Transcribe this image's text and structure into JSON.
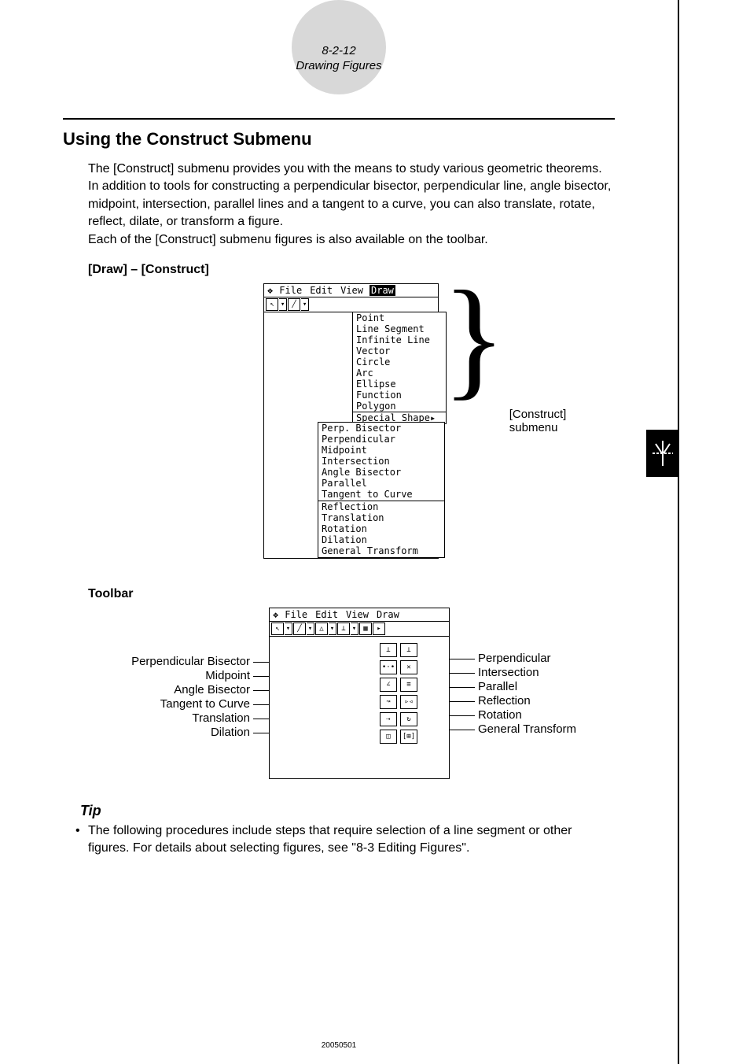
{
  "header": {
    "pageRef": "8-2-12",
    "sectionRef": "Drawing Figures"
  },
  "title": "Using the Construct Submenu",
  "para1": "The [Construct] submenu provides you with the means to study various geometric theorems. In addition to tools for constructing a perpendicular bisector, perpendicular line, angle bisector, midpoint, intersection, parallel lines and a tangent to a curve, you can also translate, rotate, reflect, dilate, or transform a figure.",
  "para2": "Each of the [Construct] submenu figures is also available on the toolbar.",
  "drawConstructLabel": "[Draw] – [Construct]",
  "menubarItems": [
    "File",
    "Edit",
    "View",
    "Draw"
  ],
  "drawMenuItems": [
    "Point",
    "Line Segment",
    "Infinite Line",
    "Vector",
    "Circle",
    "Arc",
    "Ellipse",
    "Function",
    "Polygon",
    "Special Shape▸"
  ],
  "constructGroup1": [
    "Perp. Bisector",
    "Perpendicular",
    "Midpoint",
    "Intersection",
    "Angle Bisector",
    "Parallel",
    "Tangent to Curve"
  ],
  "constructGroup2": [
    "Reflection",
    "Translation",
    "Rotation",
    "Dilation",
    "General Transform"
  ],
  "constructLabel": "[Construct] submenu",
  "toolbarLabel": "Toolbar",
  "leftLabels": [
    "Perpendicular Bisector",
    "Midpoint",
    "Angle Bisector",
    "Tangent to Curve",
    "Translation",
    "Dilation"
  ],
  "rightLabels": [
    "Perpendicular",
    "Intersection",
    "Parallel",
    "Reflection",
    "Rotation",
    "General Transform"
  ],
  "tipHead": "Tip",
  "tipBullet": "The following procedures include steps that require selection of a line segment or other figures. For details about selecting figures, see \"8-3 Editing Figures\".",
  "footer": "20050501"
}
